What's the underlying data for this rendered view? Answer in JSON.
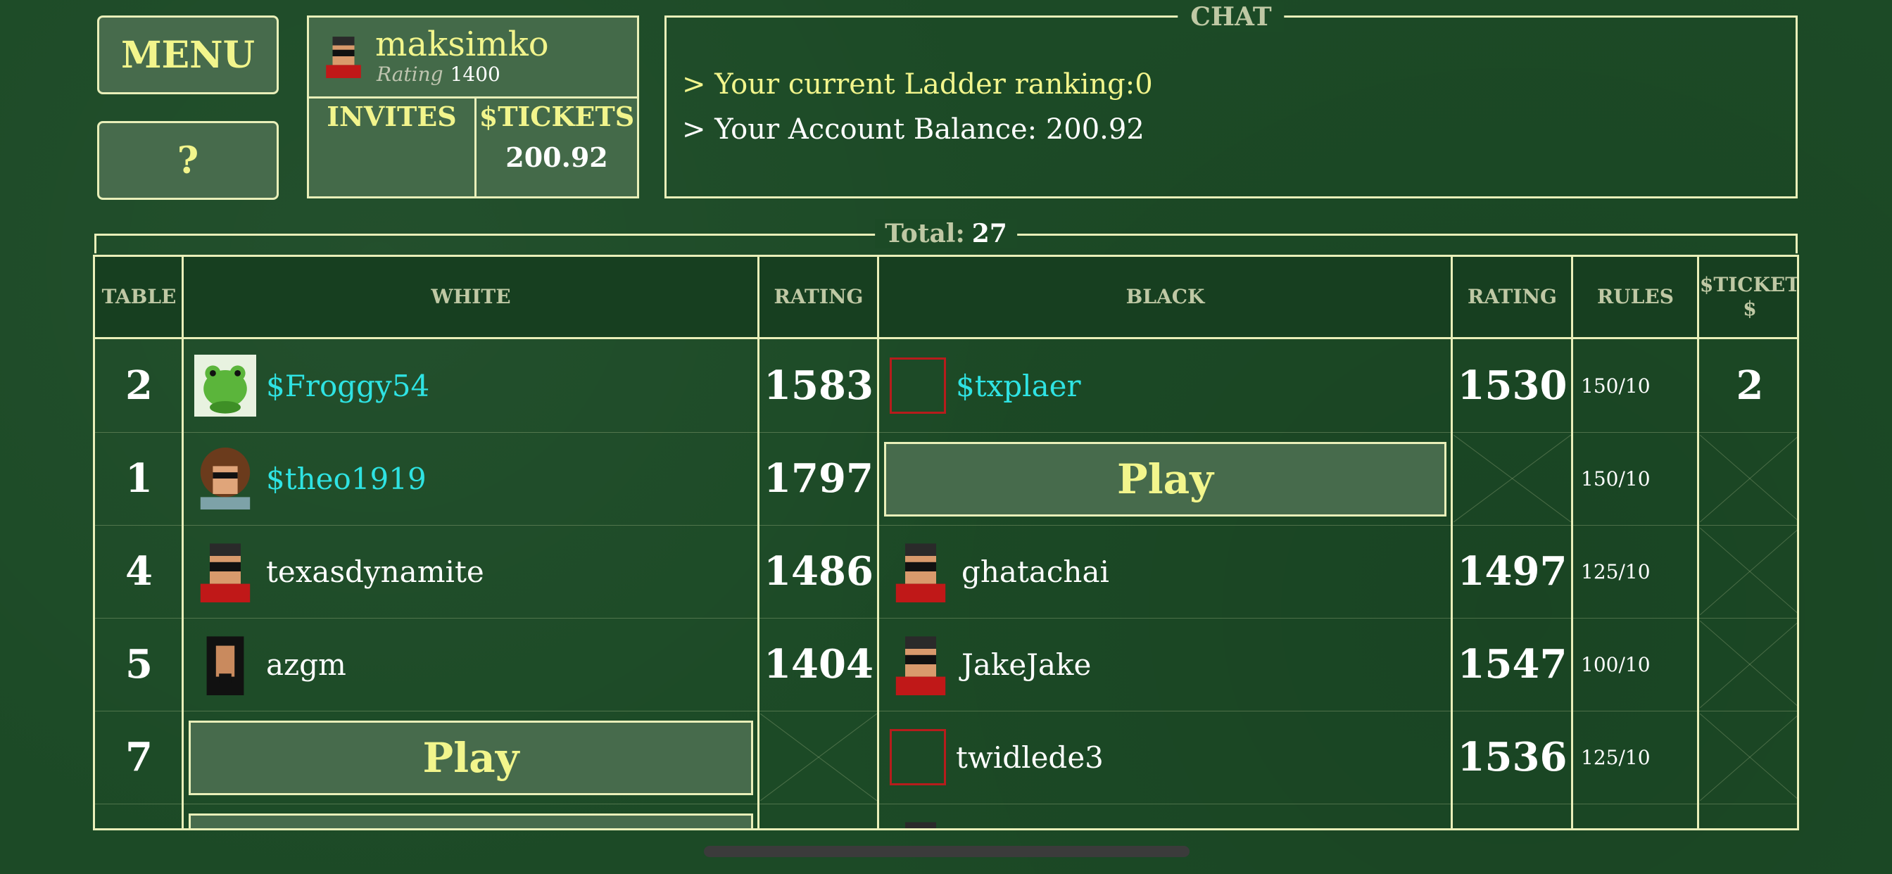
{
  "menu": {
    "label": "MENU"
  },
  "help": {
    "label": "?"
  },
  "profile": {
    "username": "maksimko",
    "rating_label": "Rating",
    "rating_value": "1400",
    "invites_label": "INVITES",
    "invites_value": "",
    "tickets_label": "$TICKETS",
    "tickets_value": "200.92"
  },
  "chat": {
    "title": "CHAT",
    "lines": [
      {
        "text": "> Your current Ladder ranking:0",
        "color": "#f2f58c"
      },
      {
        "text": "> Your Account Balance: 200.92",
        "color": "#ffffff"
      }
    ]
  },
  "total": {
    "label": "Total:",
    "value": "27"
  },
  "table": {
    "headers": [
      "TABLE",
      "WHITE",
      "RATING",
      "BLACK",
      "RATING",
      "RULES",
      "$TICKET\n$"
    ],
    "rows": [
      {
        "table": "2",
        "white": {
          "name": "$Froggy54",
          "cyan": true,
          "avatar": "frog-avatar"
        },
        "white_rating": "1583",
        "black": {
          "name": "$txplaer",
          "cyan": true,
          "avatar": "empty-seat"
        },
        "black_rating": "1530",
        "rules": "150/10",
        "tickets": "2"
      },
      {
        "table": "1",
        "white": {
          "name": "$theo1919",
          "cyan": true,
          "avatar": "curly-hair-avatar"
        },
        "white_rating": "1797",
        "black": {
          "play": "Play"
        },
        "black_rating": "",
        "rules": "150/10",
        "tickets": ""
      },
      {
        "table": "4",
        "white": {
          "name": "texasdynamite",
          "cyan": false,
          "avatar": "sunglasses-man-avatar"
        },
        "white_rating": "1486",
        "black": {
          "name": "ghatachai",
          "cyan": false,
          "avatar": "sunglasses-man-avatar"
        },
        "black_rating": "1497",
        "rules": "125/10",
        "tickets": ""
      },
      {
        "table": "5",
        "white": {
          "name": "azgm",
          "cyan": false,
          "avatar": "long-hair-woman-avatar"
        },
        "white_rating": "1404",
        "black": {
          "name": "JakeJake",
          "cyan": false,
          "avatar": "sunglasses-man-avatar"
        },
        "black_rating": "1547",
        "rules": "100/10",
        "tickets": ""
      },
      {
        "table": "7",
        "white": {
          "play": "Play"
        },
        "white_rating": "",
        "black": {
          "name": "twidlede3",
          "cyan": false,
          "avatar": "empty-seat"
        },
        "black_rating": "1536",
        "rules": "125/10",
        "tickets": ""
      }
    ]
  }
}
